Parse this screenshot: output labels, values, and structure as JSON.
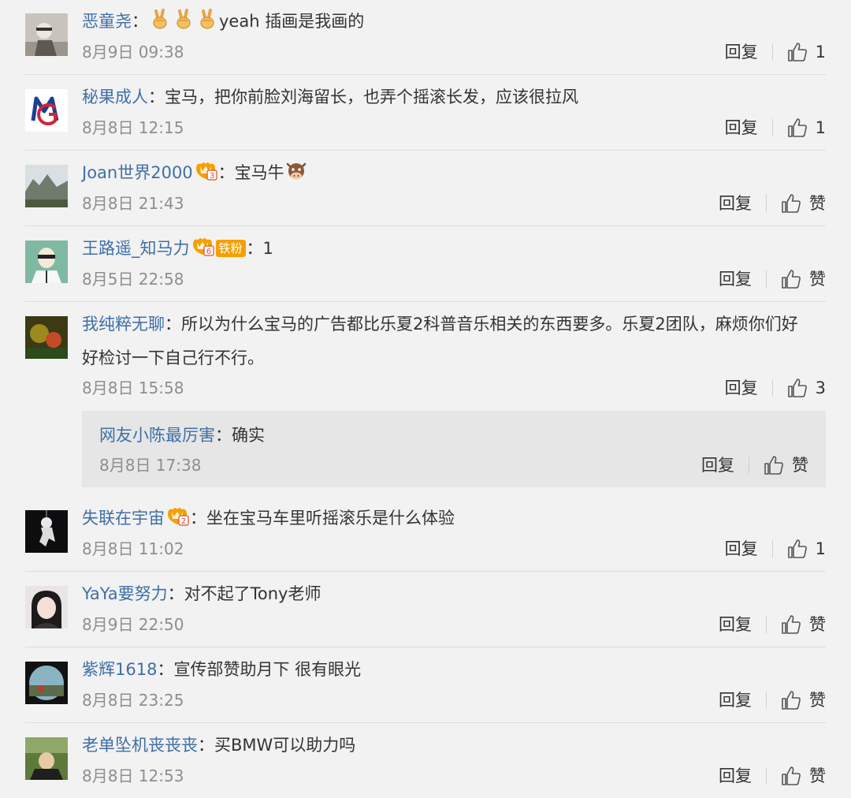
{
  "colon": "：",
  "reply_label": "回复",
  "like_label": "赞",
  "comments": [
    {
      "user": "恶童尧",
      "text": "yeah 插画是我画的",
      "time": "8月9日 09:38",
      "likes": "1",
      "emoji": [
        "victory-hand",
        "victory-hand",
        "victory-hand"
      ]
    },
    {
      "user": "秘果成人",
      "text": "宝马，把你前脸刘海留长，也弄个摇滚长发，应该很拉风",
      "time": "8月8日 12:15",
      "likes": "1"
    },
    {
      "user": "Joan世界2000",
      "text": "宝马牛",
      "time": "8月8日 21:43",
      "likes": "赞",
      "badge_level": "3",
      "emoji": [
        "cow-face"
      ]
    },
    {
      "user": "王路遥_知马力",
      "text": "1",
      "time": "8月5日 22:58",
      "likes": "赞",
      "badge_level": "6",
      "fan_badge": "铁粉"
    },
    {
      "user": "我纯粹无聊",
      "text": "所以为什么宝马的广告都比乐夏2科普音乐相关的东西要多。乐夏2团队，麻烦你们好",
      "text_line2": "好检讨一下自己行不行。",
      "time": "8月8日 15:58",
      "likes": "3",
      "reply": {
        "user": "网友小陈最厉害",
        "text": "确实",
        "time": "8月8日 17:38",
        "likes": "赞"
      }
    },
    {
      "user": "失联在宇宙",
      "text": "坐在宝马车里听摇滚乐是什么体验",
      "time": "8月8日 11:02",
      "likes": "1",
      "badge_level": "2"
    },
    {
      "user": "YaYa要努力",
      "text": "对不起了Tony老师",
      "time": "8月9日 22:50",
      "likes": "赞"
    },
    {
      "user": "紫辉1618",
      "text": "宣传部赞助月下 很有眼光",
      "time": "8月8日 23:25",
      "likes": "赞"
    },
    {
      "user": "老单坠机丧丧丧",
      "text": "买BMW可以助力吗",
      "time": "8月8日 12:53",
      "likes": "赞"
    }
  ],
  "colors": {
    "name_blue": "#3f6fa5",
    "time_gray": "#8e8e8e",
    "background": "#f2f2f2",
    "reply_box": "#e6e6e6",
    "badge_orange": "#f5a000"
  }
}
